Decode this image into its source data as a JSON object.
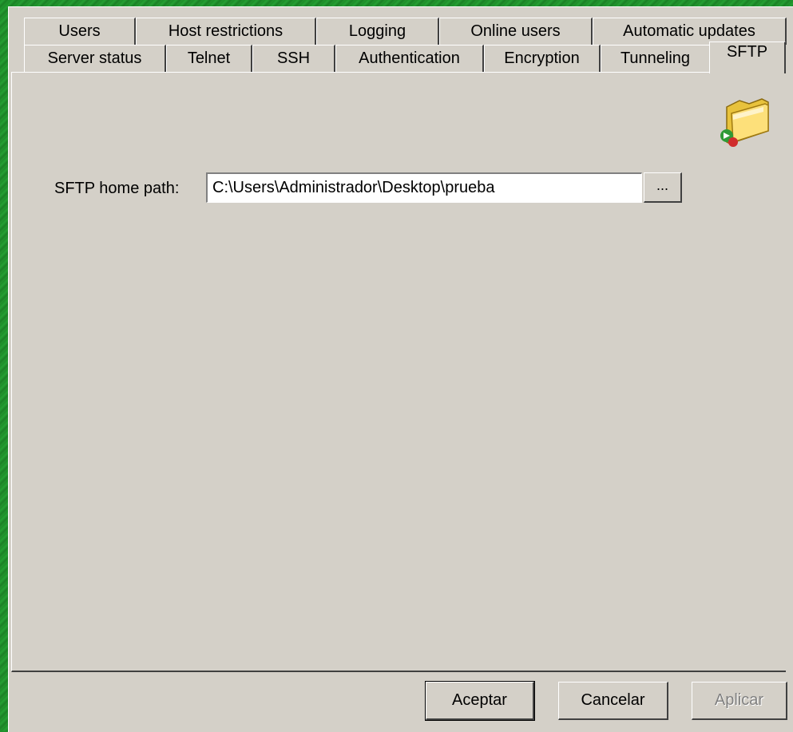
{
  "tabs_row1": [
    {
      "label": "Users"
    },
    {
      "label": "Host restrictions"
    },
    {
      "label": "Logging"
    },
    {
      "label": "Online users"
    },
    {
      "label": "Automatic updates"
    }
  ],
  "tabs_row2": [
    {
      "label": "Server status"
    },
    {
      "label": "Telnet"
    },
    {
      "label": "SSH"
    },
    {
      "label": "Authentication"
    },
    {
      "label": "Encryption"
    },
    {
      "label": "Tunneling"
    },
    {
      "label": "SFTP",
      "active": true
    }
  ],
  "sftp": {
    "home_path_label": "SFTP home path:",
    "home_path_value": "C:\\Users\\Administrador\\Desktop\\prueba",
    "browse_label": "...",
    "icon": "folder-icon"
  },
  "buttons": {
    "ok": "Aceptar",
    "cancel": "Cancelar",
    "apply": "Aplicar"
  }
}
